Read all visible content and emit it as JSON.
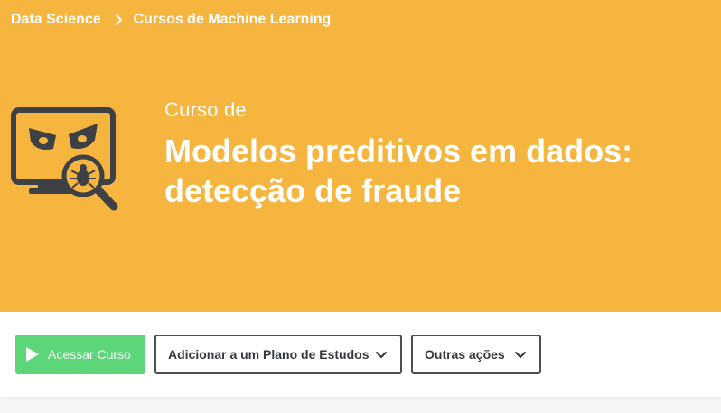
{
  "breadcrumb": {
    "items": [
      "Data Science",
      "Cursos de Machine Learning"
    ]
  },
  "course": {
    "prefix": "Curso de",
    "title_line1": "Modelos preditivos em dados:",
    "title_line2": "detecção de fraude",
    "icon": "fraud-detection-monitor-icon"
  },
  "actions": {
    "access_label": "Acessar Curso",
    "plan_label": "Adicionar a um Plano de Estudos",
    "more_label": "Outras ações"
  },
  "colors": {
    "hero_bg": "#f6b53f",
    "primary_button": "#5cd679",
    "dark": "#3d4044"
  }
}
